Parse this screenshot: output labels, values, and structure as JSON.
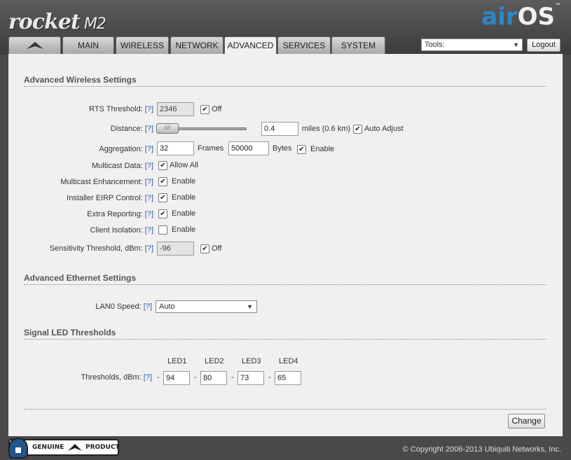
{
  "header": {
    "brand": "rocket",
    "model": "M2",
    "air": "air",
    "os": "OS",
    "tm": "™"
  },
  "tabs": [
    {
      "label": "",
      "icon": "ubiquiti-logo-icon"
    },
    {
      "label": "MAIN"
    },
    {
      "label": "WIRELESS"
    },
    {
      "label": "NETWORK"
    },
    {
      "label": "ADVANCED",
      "active": true
    },
    {
      "label": "SERVICES"
    },
    {
      "label": "SYSTEM"
    }
  ],
  "tools": {
    "value": "Tools:",
    "logout_label": "Logout"
  },
  "help": "[?]",
  "wireless": {
    "title": "Advanced Wireless Settings",
    "rts": {
      "label": "RTS Threshold:",
      "value": "2346",
      "off_label": "Off",
      "off_checked": true
    },
    "distance": {
      "label": "Distance:",
      "value": "0.4",
      "unit_text": "miles (0.6 km)",
      "auto_label": "Auto Adjust",
      "auto_checked": true,
      "slider_fraction": 0.05
    },
    "aggregation": {
      "label": "Aggregation:",
      "frames_value": "32",
      "frames_label": "Frames",
      "bytes_value": "50000",
      "bytes_label": "Bytes",
      "enable_label": "Enable",
      "enable_checked": true
    },
    "multicast": {
      "label": "Multicast Data:",
      "check_label": "Allow All",
      "checked": true
    },
    "mcast_enh": {
      "label": "Multicast Enhancement:",
      "check_label": "Enable",
      "checked": true
    },
    "eirp": {
      "label": "Installer EIRP Control:",
      "check_label": "Enable",
      "checked": true
    },
    "extra": {
      "label": "Extra Reporting:",
      "check_label": "Enable",
      "checked": true
    },
    "isolation": {
      "label": "Client Isolation:",
      "check_label": "Enable",
      "checked": false
    },
    "sensitivity": {
      "label": "Sensitivity Threshold, dBm:",
      "value": "-96",
      "off_label": "Off",
      "off_checked": true
    }
  },
  "ethernet": {
    "title": "Advanced Ethernet Settings",
    "lan0": {
      "label": "LAN0 Speed:",
      "value": "Auto"
    }
  },
  "led": {
    "title": "Signal LED Thresholds",
    "thresholds_label": "Thresholds, dBm:",
    "dash": "-",
    "leds": [
      {
        "name": "LED1",
        "value": "94"
      },
      {
        "name": "LED2",
        "value": "80"
      },
      {
        "name": "LED3",
        "value": "73"
      },
      {
        "name": "LED4",
        "value": "65"
      }
    ]
  },
  "change_label": "Change",
  "footer": {
    "badge_left": "GENUINE",
    "badge_right": "PRODUCT",
    "copyright": "© Copyright 2006-2013 Ubiquiti Networks, Inc."
  },
  "colors": {
    "accent": "#2c87c6",
    "header": "#4a4a4a",
    "panel": "#f0f0f0"
  }
}
